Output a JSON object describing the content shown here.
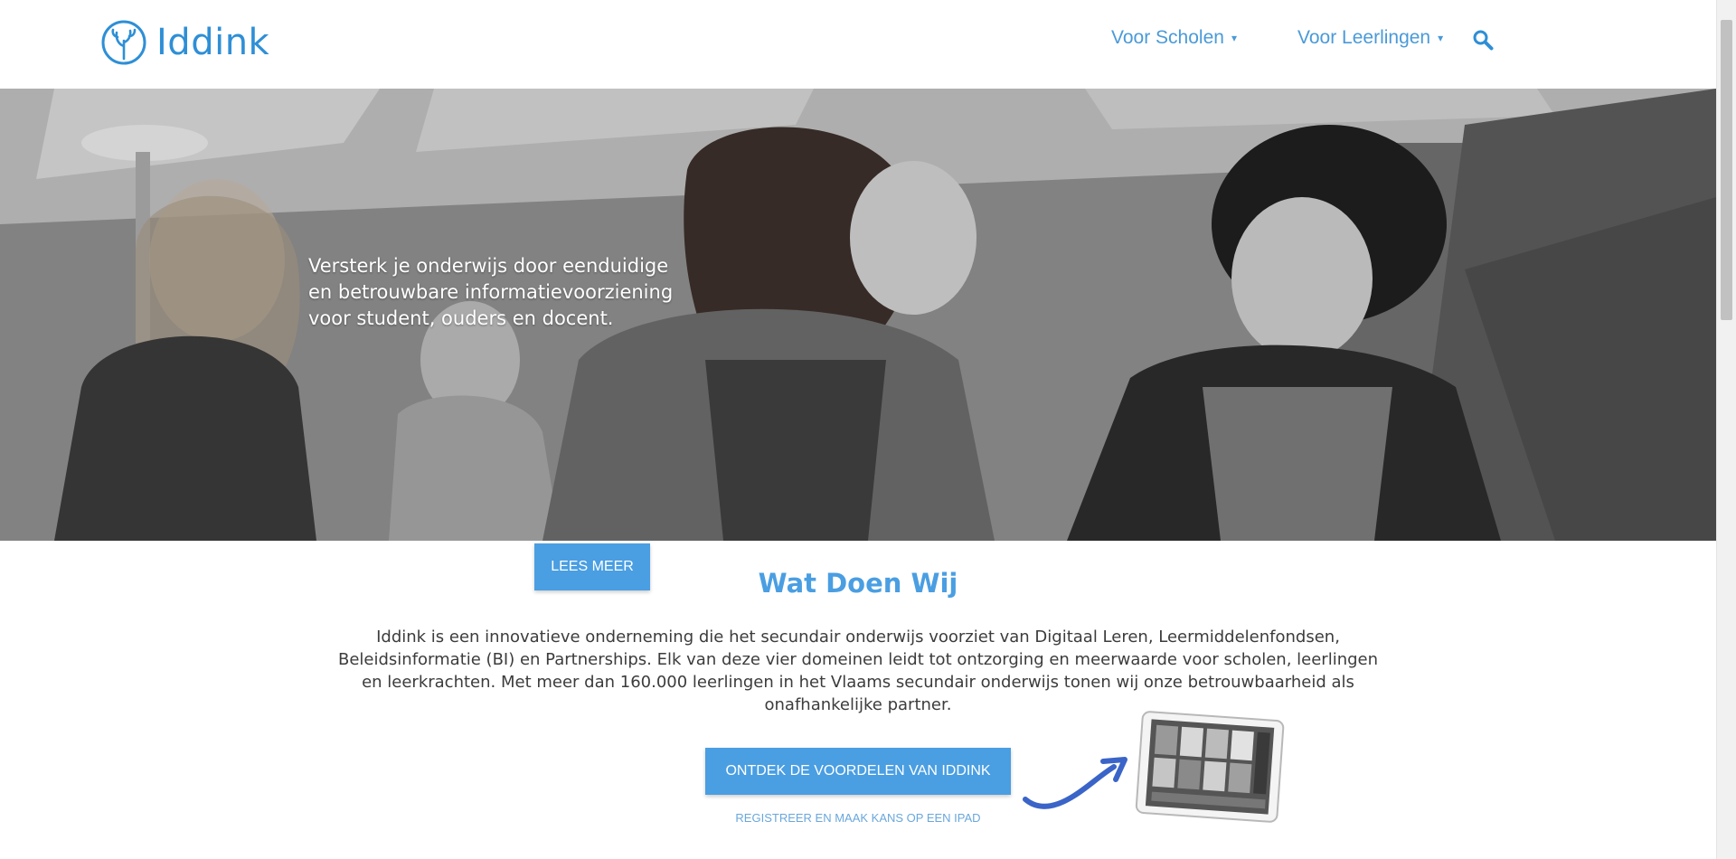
{
  "header": {
    "logo_text": "Iddink",
    "nav": [
      {
        "label": "Voor Scholen",
        "caret": "▾"
      },
      {
        "label": "Voor Leerlingen",
        "caret": "▾"
      }
    ]
  },
  "hero": {
    "tagline": "Versterk je onderwijs door eenduidige en betrouwbare informatievoorziening voor student, ouders en docent.",
    "cta_label": "LEES MEER"
  },
  "section": {
    "title": "Wat Doen Wij",
    "body": "Iddink is een innovatieve onderneming die het secundair onderwijs voorziet van Digitaal Leren, Leermiddelenfondsen, Beleidsinformatie (BI) en Partnerships. Elk van deze vier domeinen leidt tot ontzorging en meerwaarde voor scholen, leerlingen en leerkrachten. Met meer dan 160.000 leerlingen in het Vlaams secundair onderwijs tonen wij onze betrouwbaarheid als onafhankelijke partner.",
    "cta_label": "ONTDEK DE VOORDELEN VAN IDDINK",
    "register_link": "REGISTREER EN MAAK KANS OP EEN IPAD"
  },
  "colors": {
    "brand_blue": "#2e8fd6",
    "button_blue": "#4a9ee2",
    "link_blue": "#6aa7dc"
  },
  "icons": [
    "iddink-logo-icon",
    "search-icon",
    "arrow-icon",
    "ipad-image"
  ]
}
